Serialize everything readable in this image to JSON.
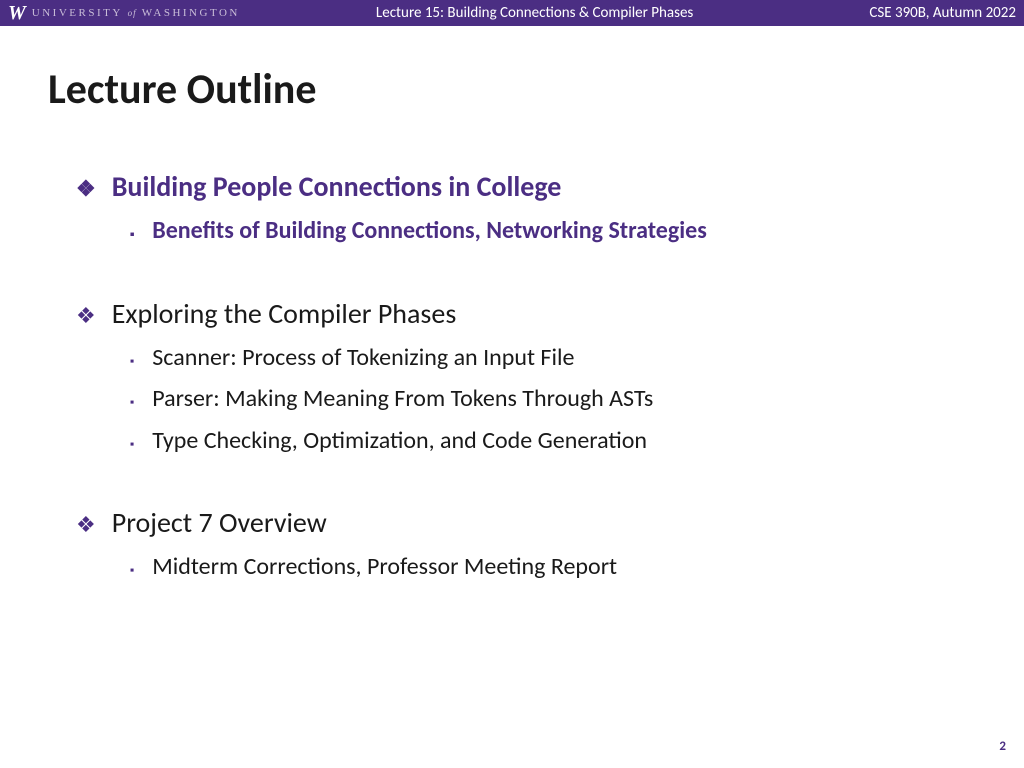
{
  "header": {
    "logo_letter": "W",
    "university_text_1": "UNIVERSITY",
    "university_text_of": "of",
    "university_text_2": "WASHINGTON",
    "lecture_title": "Lecture 15: Building Connections & Compiler Phases",
    "course_label": "CSE 390B, Autumn 2022"
  },
  "title": "Lecture Outline",
  "sections": [
    {
      "heading": "Building People Connections in College",
      "highlighted": true,
      "subs": [
        {
          "text": "Benefits of Building Connections, Networking Strategies",
          "highlighted": true
        }
      ]
    },
    {
      "heading": "Exploring the Compiler Phases",
      "highlighted": false,
      "subs": [
        {
          "text": "Scanner: Process of Tokenizing an Input File",
          "highlighted": false
        },
        {
          "text": "Parser: Making Meaning From Tokens Through ASTs",
          "highlighted": false
        },
        {
          "text": "Type Checking, Optimization, and Code Generation",
          "highlighted": false
        }
      ]
    },
    {
      "heading": "Project 7 Overview",
      "highlighted": false,
      "subs": [
        {
          "text": "Midterm Corrections, Professor Meeting Report",
          "highlighted": false
        }
      ]
    }
  ],
  "page_number": "2"
}
